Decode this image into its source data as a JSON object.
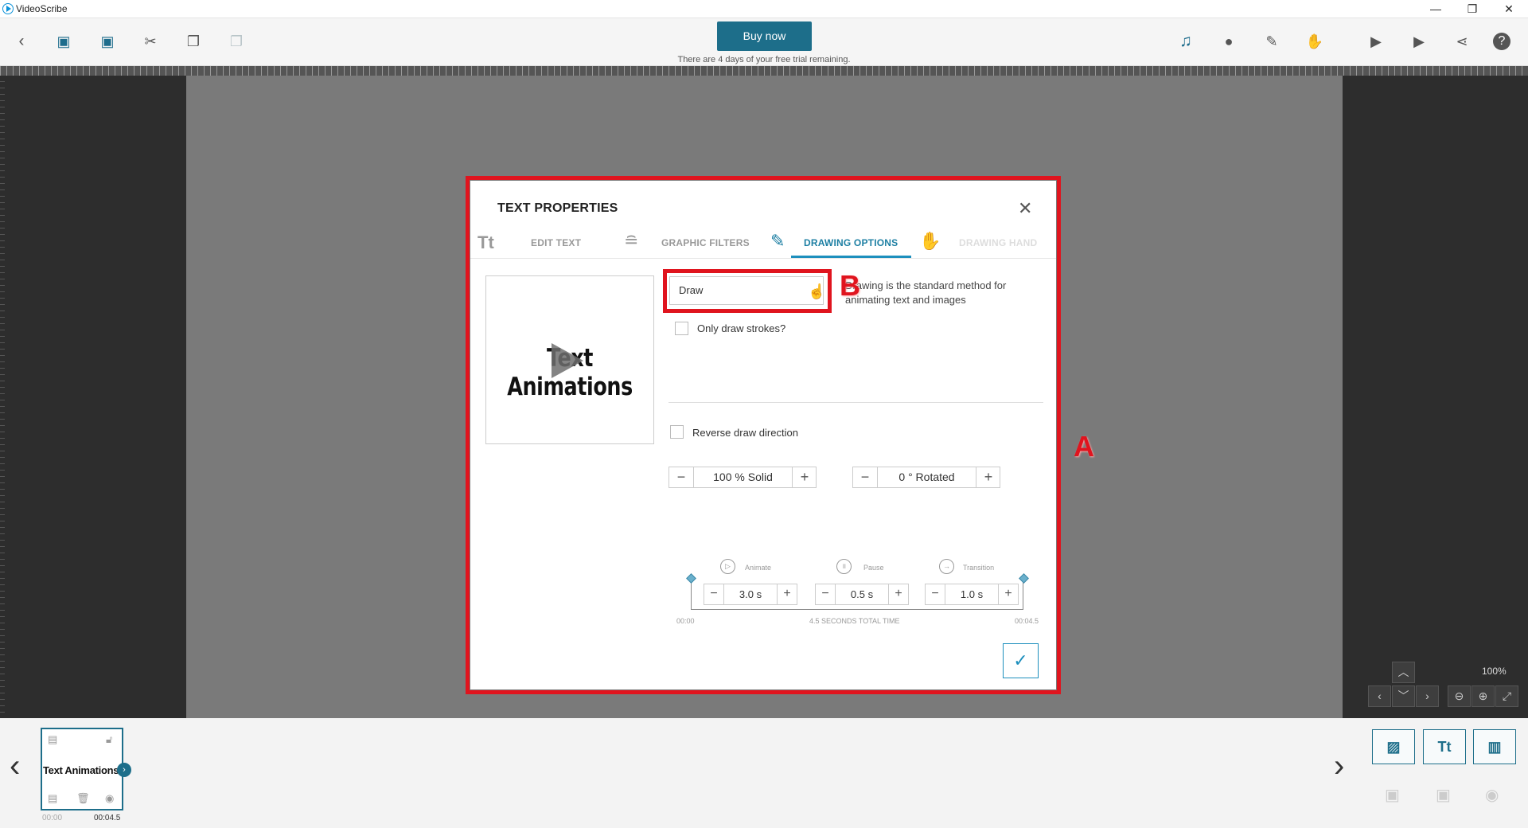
{
  "window": {
    "title": "VideoScribe",
    "minimize": "—",
    "restore": "❐",
    "close": "✕"
  },
  "toolbar": {
    "buy_now": "Buy now",
    "trial_text": "There are 4 days of your free trial remaining."
  },
  "modal": {
    "title": "TEXT PROPERTIES",
    "tabs": [
      {
        "label": "EDIT TEXT",
        "icon": "text-tt-icon"
      },
      {
        "label": "GRAPHIC FILTERS",
        "icon": "filter-icon"
      },
      {
        "label": "DRAWING OPTIONS",
        "icon": "pencil-icon",
        "active": true
      },
      {
        "label": "DRAWING HAND",
        "icon": "hand-icon",
        "disabled": true
      }
    ],
    "tab_icon_tt": "Tt",
    "preview_text": "Text Animations",
    "animation_select": "Draw",
    "description": "Drawing is the standard method for animating text and images",
    "only_draw_strokes": "Only draw strokes?",
    "reverse_draw": "Reverse draw direction",
    "opacity_value": "100 % Solid",
    "rotation_value": "0 ° Rotated",
    "timing": {
      "animate_label": "Animate",
      "animate_value": "3.0 s",
      "pause_label": "Pause",
      "pause_value": "0.5 s",
      "transition_label": "Transition",
      "transition_value": "1.0 s",
      "start": "00:00",
      "total": "4.5 SECONDS TOTAL TIME",
      "end": "00:04.5"
    }
  },
  "annotations": {
    "a": "A",
    "b": "B"
  },
  "zoom": {
    "level": "100%"
  },
  "timeline": {
    "scene_title": "Text Animations",
    "time_start": "00:00",
    "time_end": "00:04.5"
  },
  "colors": {
    "accent": "#1d6e8a",
    "highlight": "#e0141e"
  }
}
